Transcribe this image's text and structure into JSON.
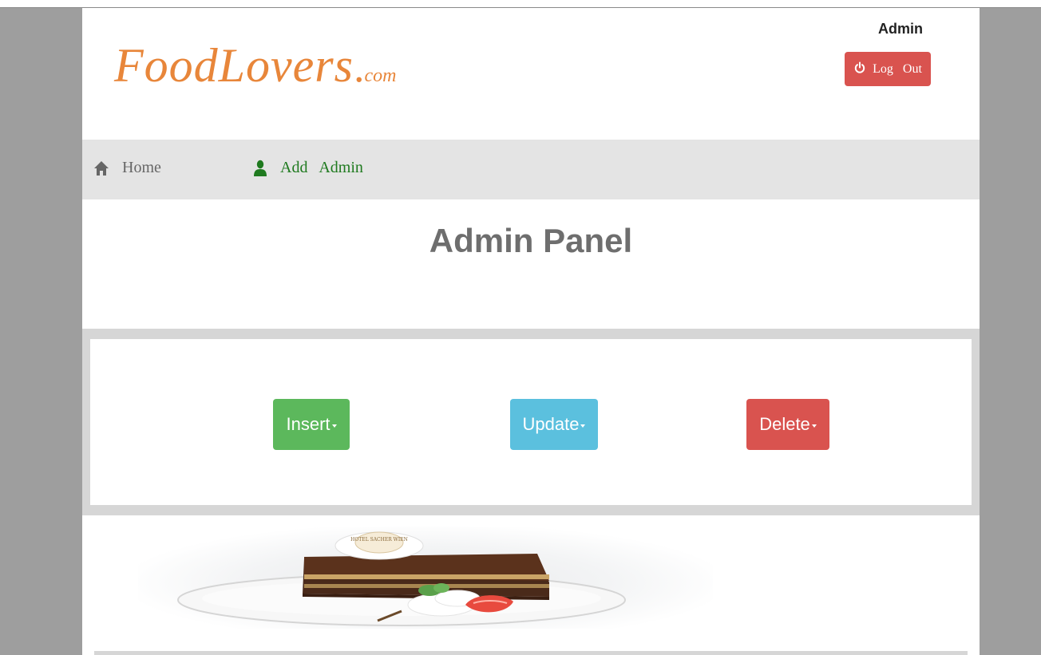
{
  "header": {
    "logo_main": "FoodLovers",
    "logo_dot": ".",
    "logo_suffix": "com",
    "user_label": "Admin",
    "logout_label": "Log Out"
  },
  "nav": {
    "home_label": "Home",
    "add_admin_label": "Add Admin"
  },
  "main": {
    "title": "Admin Panel",
    "actions": {
      "insert_label": "Insert",
      "update_label": "Update",
      "delete_label": "Delete"
    }
  },
  "banner": {
    "description_icon": "cake-image",
    "medallion_text": "HOTEL SACHER WIEN"
  },
  "colors": {
    "logo": "#e8863a",
    "danger": "#d9534f",
    "success": "#5cb85c",
    "info": "#5bc0de",
    "nav_green": "#1f7a1f"
  }
}
